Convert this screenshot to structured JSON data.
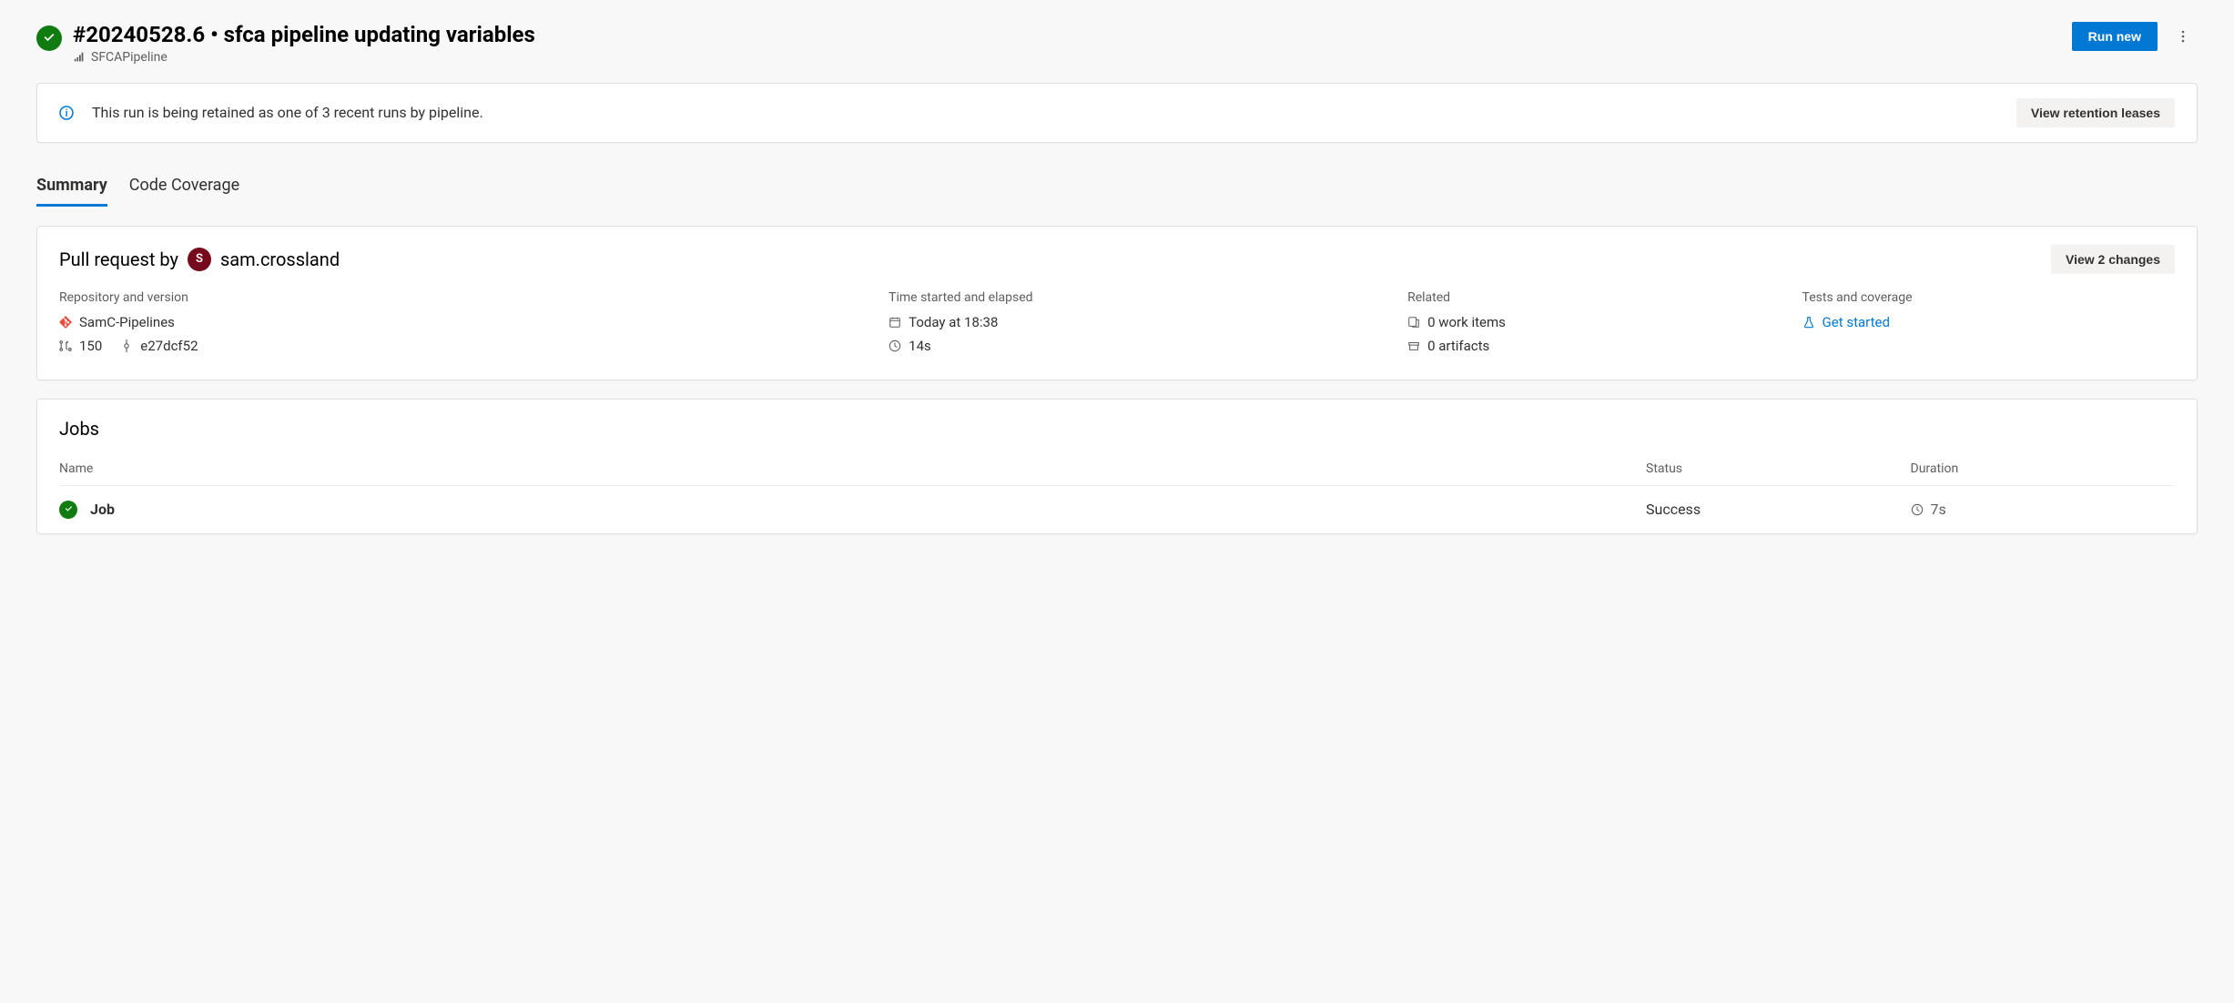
{
  "header": {
    "title": "#20240528.6 • sfca pipeline updating variables",
    "pipeline_name": "SFCAPipeline",
    "run_new_label": "Run new"
  },
  "retention": {
    "message": "This run is being retained as one of 3 recent runs by pipeline.",
    "button_label": "View retention leases"
  },
  "tabs": {
    "summary": "Summary",
    "code_coverage": "Code Coverage"
  },
  "summary": {
    "pr_prefix": "Pull request by",
    "author_initial": "S",
    "author_name": "sam.crossland",
    "view_changes_label": "View 2 changes",
    "cols": {
      "repo_title": "Repository and version",
      "repo_name": "SamC-Pipelines",
      "pr_number": "150",
      "commit": "e27dcf52",
      "time_title": "Time started and elapsed",
      "started": "Today at 18:38",
      "elapsed": "14s",
      "related_title": "Related",
      "work_items": "0 work items",
      "artifacts": "0 artifacts",
      "tests_title": "Tests and coverage",
      "get_started": "Get started"
    }
  },
  "jobs": {
    "title": "Jobs",
    "headers": {
      "name": "Name",
      "status": "Status",
      "duration": "Duration"
    },
    "rows": [
      {
        "name": "Job",
        "status": "Success",
        "duration": "7s"
      }
    ]
  }
}
